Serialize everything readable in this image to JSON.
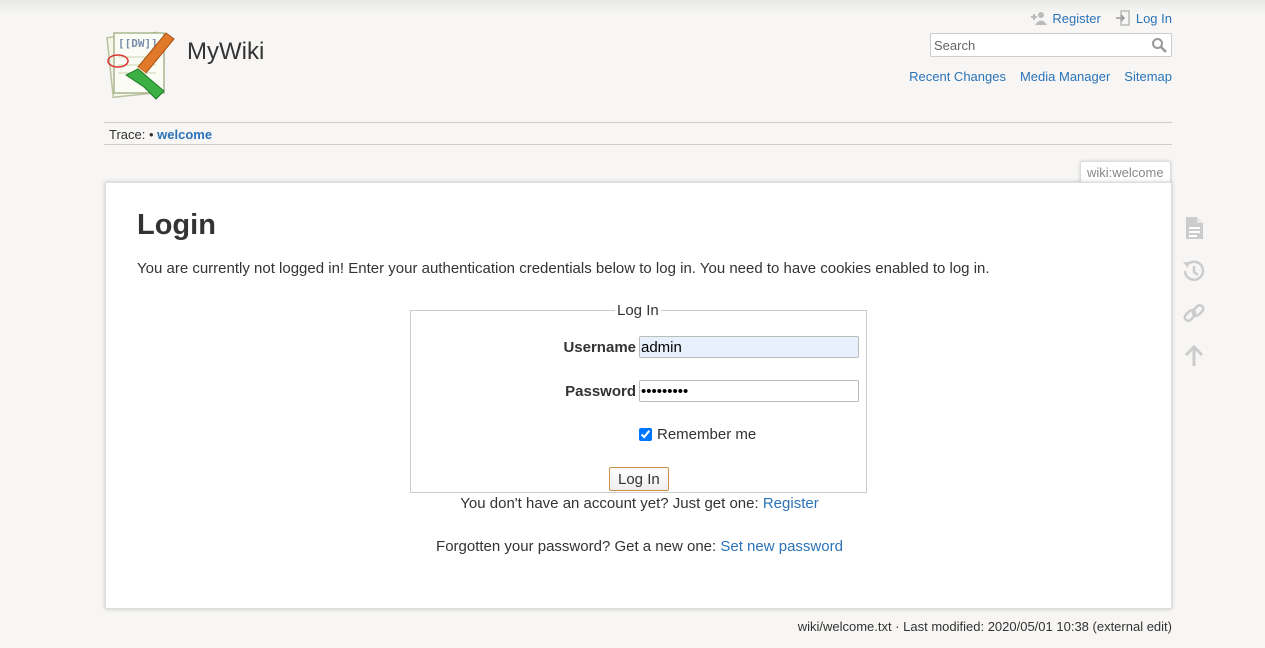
{
  "header": {
    "site_title": "MyWiki",
    "logo_text": "[[DW]]",
    "user_tools": {
      "register": "Register",
      "login": "Log In"
    },
    "search": {
      "placeholder": "Search",
      "value": ""
    },
    "site_tools": [
      "Recent Changes",
      "Media Manager",
      "Sitemap"
    ]
  },
  "breadcrumbs": {
    "label": "Trace:",
    "separator": "•",
    "current": "welcome"
  },
  "page_id": "wiki:welcome",
  "page": {
    "title": "Login",
    "intro": "You are currently not logged in! Enter your authentication credentials below to log in. You need to have cookies enabled to log in.",
    "form": {
      "legend": "Log In",
      "username_label": "Username",
      "username_value": "admin",
      "password_label": "Password",
      "password_value": "•••••••••",
      "remember_label": "Remember me",
      "remember_checked": true,
      "submit_label": "Log In"
    },
    "register_note": {
      "text": "You don't have an account yet? Just get one:",
      "link": "Register"
    },
    "reset_note": {
      "text": "Forgotten your password? Get a new one:",
      "link": "Set new password"
    }
  },
  "page_tools": [
    "show-page-icon",
    "old-revisions-icon",
    "backlinks-icon",
    "back-to-top-icon"
  ],
  "footer": {
    "docinfo": "wiki/welcome.txt · Last modified: 2020/05/01 10:38 (external edit)"
  },
  "colors": {
    "link": "#2b73b7",
    "background": "#f7f6f4",
    "page": "#ffffff"
  }
}
